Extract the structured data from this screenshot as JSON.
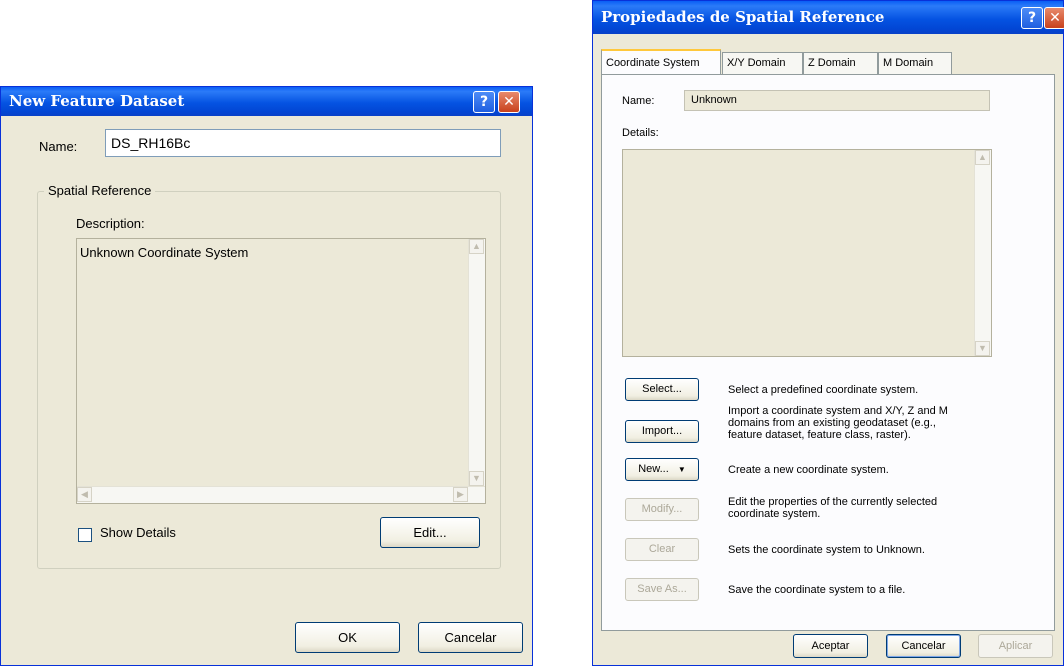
{
  "dialog_new": {
    "title": "New Feature Dataset",
    "name_label": "Name:",
    "name_value": "DS_RH16Bc",
    "group_label": "Spatial Reference",
    "description_label": "Description:",
    "description_text": "Unknown Coordinate System",
    "show_details_label": "Show Details",
    "edit_button": "Edit...",
    "ok_button": "OK",
    "cancel_button": "Cancelar"
  },
  "dialog_props": {
    "title": "Propiedades de Spatial Reference",
    "tabs": [
      {
        "label": "Coordinate System"
      },
      {
        "label": "X/Y Domain"
      },
      {
        "label": "Z Domain"
      },
      {
        "label": "M Domain"
      }
    ],
    "name_label": "Name:",
    "name_value": "Unknown",
    "details_label": "Details:",
    "actions": [
      {
        "button": "Select...",
        "description": "Select a predefined coordinate system."
      },
      {
        "button": "Import...",
        "description": "Import a coordinate system and X/Y, Z and M domains from an existing geodataset (e.g., feature dataset, feature class, raster)."
      },
      {
        "button": "New...",
        "description": "Create a new coordinate system."
      },
      {
        "button": "Modify...",
        "description": "Edit the properties of the currently selected coordinate system."
      },
      {
        "button": "Clear",
        "description": "Sets the coordinate system to Unknown."
      },
      {
        "button": "Save As...",
        "description": "Save the coordinate system to a file."
      }
    ],
    "accept_button": "Aceptar",
    "cancel_button": "Cancelar",
    "apply_button": "Aplicar"
  }
}
